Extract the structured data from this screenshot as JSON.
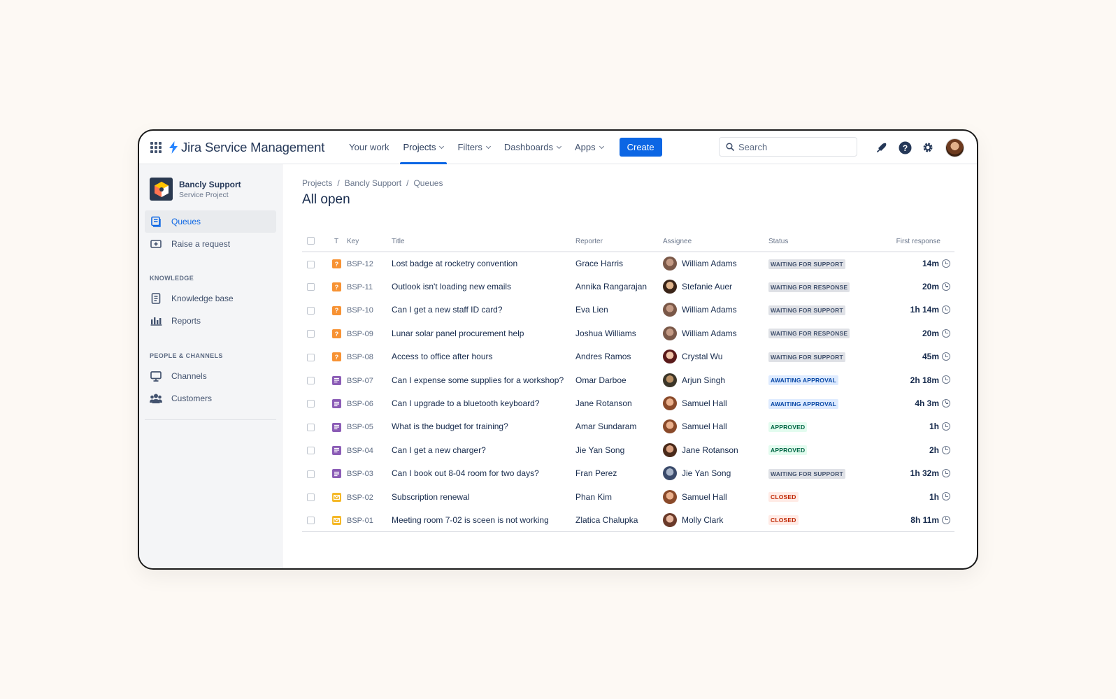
{
  "topnav": {
    "brand": "Jira Service Management",
    "items": [
      {
        "label": "Your work",
        "dropdown": false
      },
      {
        "label": "Projects",
        "dropdown": true,
        "active": true
      },
      {
        "label": "Filters",
        "dropdown": true
      },
      {
        "label": "Dashboards",
        "dropdown": true
      },
      {
        "label": "Apps",
        "dropdown": true
      }
    ],
    "create_label": "Create",
    "search_placeholder": "Search",
    "icons": [
      "notifications-icon",
      "help-icon",
      "settings-icon",
      "profile-avatar"
    ]
  },
  "sidebar": {
    "project_name": "Bancly Support",
    "project_type": "Service Project",
    "items": [
      {
        "label": "Queues",
        "icon": "queues-icon",
        "active": true
      },
      {
        "label": "Raise a request",
        "icon": "raise-request-icon"
      }
    ],
    "knowledge_heading": "KNOWLEDGE",
    "knowledge_items": [
      {
        "label": "Knowledge base",
        "icon": "knowledge-base-icon"
      },
      {
        "label": "Reports",
        "icon": "reports-icon"
      }
    ],
    "people_heading": "PEOPLE & CHANNELS",
    "people_items": [
      {
        "label": "Channels",
        "icon": "channels-icon"
      },
      {
        "label": "Customers",
        "icon": "customers-icon"
      }
    ]
  },
  "main": {
    "breadcrumb": [
      "Projects",
      "Bancly Support",
      "Queues"
    ],
    "title": "All open",
    "columns": {
      "type": "T",
      "key": "Key",
      "title": "Title",
      "reporter": "Reporter",
      "assignee": "Assignee",
      "status": "Status",
      "first_response": "First response"
    },
    "rows": [
      {
        "type": "question",
        "key": "BSP-12",
        "title": "Lost badge at rocketry convention",
        "reporter": "Grace Harris",
        "assignee": "William Adams",
        "status": "WAITING FOR SUPPORT",
        "status_kind": "default",
        "first_response": "14m"
      },
      {
        "type": "question",
        "key": "BSP-11",
        "title": "Outlook isn't loading new emails",
        "reporter": "Annika Rangarajan",
        "assignee": "Stefanie Auer",
        "status": "WAITING FOR RESPONSE",
        "status_kind": "default",
        "first_response": "20m"
      },
      {
        "type": "question",
        "key": "BSP-10",
        "title": "Can I get a new staff ID card?",
        "reporter": "Eva Lien",
        "assignee": "William Adams",
        "status": "WAITING FOR SUPPORT",
        "status_kind": "default",
        "first_response": "1h 14m"
      },
      {
        "type": "question",
        "key": "BSP-09",
        "title": "Lunar solar panel procurement help",
        "reporter": "Joshua Williams",
        "assignee": "William Adams",
        "status": "WAITING FOR RESPONSE",
        "status_kind": "default",
        "first_response": "20m"
      },
      {
        "type": "question",
        "key": "BSP-08",
        "title": "Access to office after hours",
        "reporter": "Andres Ramos",
        "assignee": "Crystal Wu",
        "status": "WAITING FOR SUPPORT",
        "status_kind": "default",
        "first_response": "45m"
      },
      {
        "type": "service",
        "key": "BSP-07",
        "title": "Can I expense some supplies for a workshop?",
        "reporter": "Omar Darboe",
        "assignee": "Arjun Singh",
        "status": "AWAITING APPROVAL",
        "status_kind": "info",
        "first_response": "2h 18m"
      },
      {
        "type": "service",
        "key": "BSP-06",
        "title": "Can I upgrade to a bluetooth keyboard?",
        "reporter": "Jane Rotanson",
        "assignee": "Samuel Hall",
        "status": "AWAITING APPROVAL",
        "status_kind": "info",
        "first_response": "4h 3m"
      },
      {
        "type": "service",
        "key": "BSP-05",
        "title": "What is the budget for training?",
        "reporter": "Amar Sundaram",
        "assignee": "Samuel Hall",
        "status": "APPROVED",
        "status_kind": "success",
        "first_response": "1h"
      },
      {
        "type": "service",
        "key": "BSP-04",
        "title": "Can I get a new charger?",
        "reporter": "Jie Yan Song",
        "assignee": "Jane Rotanson",
        "status": "APPROVED",
        "status_kind": "success",
        "first_response": "2h"
      },
      {
        "type": "service",
        "key": "BSP-03",
        "title": "Can I book out 8-04 room for two days?",
        "reporter": "Fran Perez",
        "assignee": "Jie Yan Song",
        "status": "WAITING FOR SUPPORT",
        "status_kind": "default",
        "first_response": "1h 32m"
      },
      {
        "type": "email",
        "key": "BSP-02",
        "title": "Subscription renewal",
        "reporter": "Phan Kim",
        "assignee": "Samuel Hall",
        "status": "CLOSED",
        "status_kind": "removed",
        "first_response": "1h"
      },
      {
        "type": "email",
        "key": "BSP-01",
        "title": "Meeting room 7-02 is sceen is not working",
        "reporter": "Zlatica Chalupka",
        "assignee": "Molly Clark",
        "status": "CLOSED",
        "status_kind": "removed",
        "first_response": "8h 11m"
      }
    ]
  }
}
